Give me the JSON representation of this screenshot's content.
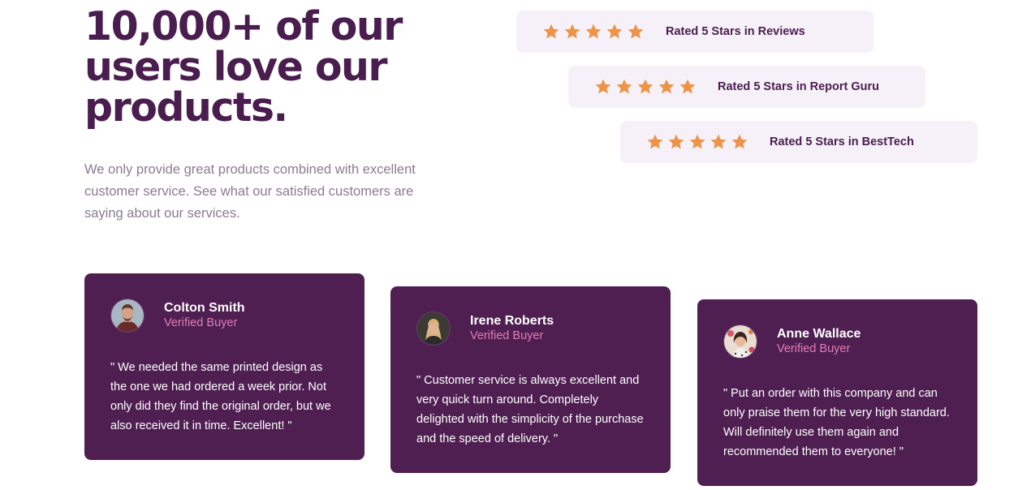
{
  "hero": {
    "headline": "10,000+ of our users love our products.",
    "description": "We only provide great products combined with excellent customer service. See what our satisfied customers are saying about our services."
  },
  "colors": {
    "primary": "#4a1d4f",
    "card_bg": "#4f1f52",
    "rating_bg": "#f6f1f8",
    "star": "#ee9449",
    "accent_pink": "#e17eb4",
    "muted_text": "#8c7a90"
  },
  "ratings": [
    {
      "stars": 5,
      "star_icon": "star-icon",
      "label": "Rated 5 Stars in Reviews"
    },
    {
      "stars": 5,
      "star_icon": "star-icon",
      "label": "Rated 5 Stars in Report Guru"
    },
    {
      "stars": 5,
      "star_icon": "star-icon",
      "label": "Rated 5 Stars in BestTech"
    }
  ],
  "testimonials": [
    {
      "name": "Colton Smith",
      "status": "Verified Buyer",
      "quote": "\" We needed the same printed design as the one we had ordered a week prior. Not only did they find the original order, but we also received it in time. Excellent! \""
    },
    {
      "name": "Irene Roberts",
      "status": "Verified Buyer",
      "quote": "\" Customer service is always excellent and very quick turn around. Completely delighted with the simplicity of the purchase and the speed of delivery. \""
    },
    {
      "name": "Anne Wallace",
      "status": "Verified Buyer",
      "quote": "\" Put an order with this company and can only praise them for the very high standard. Will definitely use them again and recommended them to everyone! \""
    }
  ]
}
